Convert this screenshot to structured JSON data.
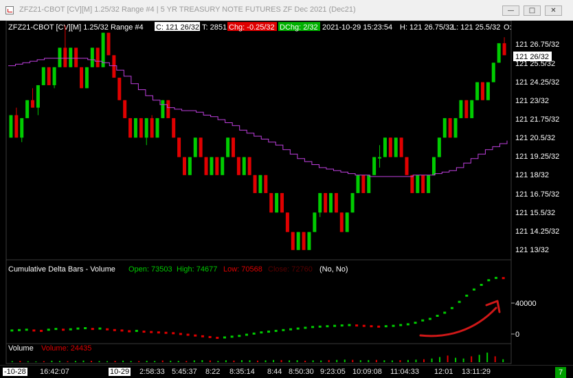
{
  "window": {
    "title": "ZFZ21-CBOT [CV][M]  1.25/32 Range  #4 | 5 YR TREASURY NOTE FUTURES ZF Dec 2021 (Dec21)",
    "min_label": "—",
    "max_label": "□",
    "close_label": "✕"
  },
  "header": {
    "symbol": "ZFZ21-CBOT [CV][M]  1.25/32 Range  #4",
    "close": "C: 121 26/32",
    "trades": "T: 2851",
    "chg": "Chg: -0.25/32",
    "dchg": "DChg: 2/32",
    "datetime": "2021-10-29 15:23:54",
    "high": "H: 121 26.75/32",
    "low": "L: 121 25.5/32",
    "open": "O:"
  },
  "price_axis": {
    "labels": [
      "121 26.75/32",
      "121 25.5/32",
      "121 24.25/32",
      "121 23/32",
      "121 21.75/32",
      "121 20.5/32",
      "121 19.25/32",
      "121 18/32",
      "121 16.75/32",
      "121 15.5/32",
      "121 14.25/32",
      "121 13/32"
    ],
    "current_label": "121 26/32"
  },
  "delta_panel": {
    "title": "Cumulative Delta Bars - Volume",
    "open": "Open: 73503",
    "high": "High: 74677",
    "low": "Low: 70568",
    "close": "Close: 72760",
    "flags": "(No, No)",
    "axis_labels": [
      "40000",
      "0"
    ]
  },
  "volume_panel": {
    "title": "Volume",
    "value": "Volume: 24435"
  },
  "time_axis": {
    "labels": [
      "-10-28",
      "16:42:07",
      "10-29",
      "2:58:33",
      "5:45:37",
      "8:22",
      "8:35:14",
      "8:44",
      "8:50:30",
      "9:23:05",
      "10:09:08",
      "11:04:33",
      "12:01",
      "13:11:29"
    ]
  },
  "badge": "7",
  "colors": {
    "up": "#00cc00",
    "down": "#e00000",
    "ma": "#c040e0",
    "annotation": "#d01818"
  },
  "chart_data": {
    "type": "candlestick",
    "price_unit": "32nds above 121",
    "candles": [
      {
        "o": 20.5,
        "h": 22.0,
        "l": 20.5,
        "c": 22.0
      },
      {
        "o": 22.0,
        "h": 22.5,
        "l": 20.5,
        "c": 20.5
      },
      {
        "o": 20.5,
        "h": 21.8,
        "l": 20.2,
        "c": 21.8
      },
      {
        "o": 21.8,
        "h": 23.0,
        "l": 21.8,
        "c": 23.0
      },
      {
        "o": 23.0,
        "h": 23.8,
        "l": 22.5,
        "c": 22.5
      },
      {
        "o": 22.5,
        "h": 24.0,
        "l": 22.0,
        "c": 24.0
      },
      {
        "o": 24.0,
        "h": 25.2,
        "l": 24.0,
        "c": 25.2
      },
      {
        "o": 25.2,
        "h": 25.2,
        "l": 24.0,
        "c": 24.0
      },
      {
        "o": 24.0,
        "h": 25.2,
        "l": 23.8,
        "c": 25.2
      },
      {
        "o": 25.2,
        "h": 26.5,
        "l": 25.2,
        "c": 26.5
      },
      {
        "o": 26.5,
        "h": 28.0,
        "l": 25.2,
        "c": 25.2
      },
      {
        "o": 25.2,
        "h": 26.5,
        "l": 25.2,
        "c": 26.5
      },
      {
        "o": 26.5,
        "h": 26.5,
        "l": 25.2,
        "c": 25.2
      },
      {
        "o": 25.2,
        "h": 25.2,
        "l": 23.8,
        "c": 23.8
      },
      {
        "o": 23.8,
        "h": 25.2,
        "l": 23.8,
        "c": 25.2
      },
      {
        "o": 25.2,
        "h": 26.5,
        "l": 25.2,
        "c": 26.5
      },
      {
        "o": 26.5,
        "h": 26.5,
        "l": 25.2,
        "c": 25.2
      },
      {
        "o": 25.2,
        "h": 27.5,
        "l": 25.2,
        "c": 27.5
      },
      {
        "o": 27.5,
        "h": 27.5,
        "l": 26.0,
        "c": 26.0
      },
      {
        "o": 26.0,
        "h": 26.0,
        "l": 24.5,
        "c": 24.5
      },
      {
        "o": 24.5,
        "h": 24.5,
        "l": 23.0,
        "c": 23.0
      },
      {
        "o": 23.0,
        "h": 23.0,
        "l": 21.8,
        "c": 21.8
      },
      {
        "o": 21.8,
        "h": 21.8,
        "l": 20.5,
        "c": 20.5
      },
      {
        "o": 20.5,
        "h": 21.8,
        "l": 20.5,
        "c": 21.8
      },
      {
        "o": 21.8,
        "h": 21.8,
        "l": 20.5,
        "c": 20.5
      },
      {
        "o": 20.5,
        "h": 21.8,
        "l": 20.0,
        "c": 21.8
      },
      {
        "o": 21.8,
        "h": 22.0,
        "l": 20.5,
        "c": 20.5
      },
      {
        "o": 20.5,
        "h": 21.8,
        "l": 20.5,
        "c": 21.8
      },
      {
        "o": 21.8,
        "h": 23.0,
        "l": 21.8,
        "c": 23.0
      },
      {
        "o": 23.0,
        "h": 23.0,
        "l": 21.8,
        "c": 21.8
      },
      {
        "o": 21.8,
        "h": 21.8,
        "l": 20.5,
        "c": 20.5
      },
      {
        "o": 20.5,
        "h": 20.5,
        "l": 19.2,
        "c": 19.2
      },
      {
        "o": 19.2,
        "h": 19.2,
        "l": 18.0,
        "c": 18.0
      },
      {
        "o": 18.0,
        "h": 19.2,
        "l": 18.0,
        "c": 19.2
      },
      {
        "o": 19.2,
        "h": 20.5,
        "l": 19.2,
        "c": 20.5
      },
      {
        "o": 20.5,
        "h": 20.5,
        "l": 19.2,
        "c": 19.2
      },
      {
        "o": 19.2,
        "h": 19.2,
        "l": 18.0,
        "c": 18.0
      },
      {
        "o": 18.0,
        "h": 19.2,
        "l": 18.0,
        "c": 19.2
      },
      {
        "o": 19.2,
        "h": 19.2,
        "l": 18.0,
        "c": 18.0
      },
      {
        "o": 18.0,
        "h": 19.2,
        "l": 18.0,
        "c": 19.2
      },
      {
        "o": 19.2,
        "h": 20.5,
        "l": 19.2,
        "c": 20.5
      },
      {
        "o": 20.5,
        "h": 20.5,
        "l": 19.2,
        "c": 19.2
      },
      {
        "o": 19.2,
        "h": 19.2,
        "l": 18.0,
        "c": 18.0
      },
      {
        "o": 18.0,
        "h": 19.2,
        "l": 18.0,
        "c": 19.2
      },
      {
        "o": 19.2,
        "h": 19.2,
        "l": 18.0,
        "c": 18.0
      },
      {
        "o": 18.0,
        "h": 18.0,
        "l": 16.8,
        "c": 16.8
      },
      {
        "o": 16.8,
        "h": 18.0,
        "l": 16.8,
        "c": 18.0
      },
      {
        "o": 18.0,
        "h": 18.0,
        "l": 16.8,
        "c": 16.8
      },
      {
        "o": 16.8,
        "h": 16.8,
        "l": 15.5,
        "c": 15.5
      },
      {
        "o": 15.5,
        "h": 16.8,
        "l": 15.5,
        "c": 16.8
      },
      {
        "o": 16.8,
        "h": 16.8,
        "l": 15.5,
        "c": 15.5
      },
      {
        "o": 15.5,
        "h": 15.5,
        "l": 14.2,
        "c": 14.2
      },
      {
        "o": 14.2,
        "h": 14.2,
        "l": 13.0,
        "c": 13.0
      },
      {
        "o": 13.0,
        "h": 14.2,
        "l": 13.0,
        "c": 14.2
      },
      {
        "o": 14.2,
        "h": 14.2,
        "l": 13.0,
        "c": 13.0
      },
      {
        "o": 13.0,
        "h": 14.2,
        "l": 13.0,
        "c": 14.2
      },
      {
        "o": 14.2,
        "h": 15.5,
        "l": 14.2,
        "c": 15.5
      },
      {
        "o": 15.5,
        "h": 16.8,
        "l": 15.2,
        "c": 16.8
      },
      {
        "o": 16.8,
        "h": 16.8,
        "l": 15.5,
        "c": 15.5
      },
      {
        "o": 15.5,
        "h": 16.8,
        "l": 15.5,
        "c": 16.8
      },
      {
        "o": 16.8,
        "h": 16.8,
        "l": 15.5,
        "c": 15.5
      },
      {
        "o": 15.5,
        "h": 15.5,
        "l": 14.2,
        "c": 14.2
      },
      {
        "o": 14.2,
        "h": 15.5,
        "l": 14.2,
        "c": 15.5
      },
      {
        "o": 15.5,
        "h": 16.8,
        "l": 15.5,
        "c": 16.8
      },
      {
        "o": 16.8,
        "h": 18.0,
        "l": 16.8,
        "c": 18.0
      },
      {
        "o": 18.0,
        "h": 18.0,
        "l": 16.8,
        "c": 16.8
      },
      {
        "o": 16.8,
        "h": 18.0,
        "l": 16.8,
        "c": 18.0
      },
      {
        "o": 18.0,
        "h": 19.2,
        "l": 18.0,
        "c": 19.2
      },
      {
        "o": 19.2,
        "h": 20.0,
        "l": 18.5,
        "c": 19.2
      },
      {
        "o": 19.2,
        "h": 20.5,
        "l": 19.2,
        "c": 20.5
      },
      {
        "o": 20.5,
        "h": 20.5,
        "l": 19.2,
        "c": 19.2
      },
      {
        "o": 19.2,
        "h": 20.5,
        "l": 19.2,
        "c": 20.5
      },
      {
        "o": 20.5,
        "h": 20.5,
        "l": 19.2,
        "c": 19.2
      },
      {
        "o": 19.2,
        "h": 19.2,
        "l": 18.0,
        "c": 18.0
      },
      {
        "o": 18.0,
        "h": 18.0,
        "l": 16.8,
        "c": 16.8
      },
      {
        "o": 16.8,
        "h": 18.0,
        "l": 16.8,
        "c": 18.0
      },
      {
        "o": 18.0,
        "h": 18.0,
        "l": 16.8,
        "c": 16.8
      },
      {
        "o": 16.8,
        "h": 18.0,
        "l": 16.8,
        "c": 18.0
      },
      {
        "o": 18.0,
        "h": 19.2,
        "l": 18.0,
        "c": 19.2
      },
      {
        "o": 19.2,
        "h": 20.5,
        "l": 19.2,
        "c": 20.5
      },
      {
        "o": 20.5,
        "h": 21.8,
        "l": 20.5,
        "c": 21.8
      },
      {
        "o": 21.8,
        "h": 21.8,
        "l": 20.5,
        "c": 20.5
      },
      {
        "o": 20.5,
        "h": 21.8,
        "l": 20.5,
        "c": 21.8
      },
      {
        "o": 21.8,
        "h": 23.0,
        "l": 21.8,
        "c": 23.0
      },
      {
        "o": 23.0,
        "h": 23.0,
        "l": 21.8,
        "c": 21.8
      },
      {
        "o": 21.8,
        "h": 23.0,
        "l": 21.8,
        "c": 23.0
      },
      {
        "o": 23.0,
        "h": 24.2,
        "l": 23.0,
        "c": 24.2
      },
      {
        "o": 24.2,
        "h": 24.2,
        "l": 23.0,
        "c": 23.0
      },
      {
        "o": 23.0,
        "h": 24.2,
        "l": 23.0,
        "c": 24.2
      },
      {
        "o": 24.2,
        "h": 25.5,
        "l": 24.2,
        "c": 25.5
      },
      {
        "o": 25.5,
        "h": 26.8,
        "l": 25.5,
        "c": 26.8
      },
      {
        "o": 26.8,
        "h": 27.2,
        "l": 26.0,
        "c": 26.0
      }
    ],
    "ma": [
      25.3,
      25.4,
      25.5,
      25.6,
      25.7,
      25.8,
      25.8,
      25.8,
      25.8,
      25.8,
      25.8,
      25.7,
      25.6,
      25.5,
      25.3,
      25.0,
      24.6,
      24.1,
      23.7,
      23.3,
      23.0,
      22.7,
      22.5,
      22.4,
      22.3,
      22.3,
      22.2,
      22.0,
      21.9,
      21.7,
      21.5,
      21.3,
      21.0,
      20.8,
      20.6,
      20.4,
      20.2,
      20.0,
      19.7,
      19.4,
      19.1,
      18.9,
      18.7,
      18.5,
      18.4,
      18.3,
      18.2,
      18.1,
      18.0,
      18.0,
      17.9,
      17.9,
      17.9,
      17.9,
      17.9,
      17.9,
      18.0,
      18.0,
      18.0,
      18.1,
      18.2,
      18.3,
      18.5,
      18.8,
      19.1,
      19.4,
      19.7,
      19.9,
      20.1,
      20.3
    ],
    "cum_delta": [
      5000,
      5500,
      6000,
      5000,
      4500,
      6000,
      7000,
      6000,
      6500,
      7500,
      8000,
      7000,
      7500,
      6500,
      5500,
      5000,
      4000,
      4500,
      3500,
      3000,
      2500,
      2000,
      1500,
      500,
      -500,
      -1500,
      -2500,
      -3500,
      -4500,
      -4000,
      -3000,
      -2000,
      -500,
      1000,
      2500,
      3500,
      4500,
      5500,
      6500,
      7500,
      8500,
      9500,
      10000,
      10500,
      11000,
      11500,
      12000,
      11500,
      11000,
      10500,
      10000,
      10500,
      11000,
      12000,
      13000,
      15000,
      18000,
      20000,
      24000,
      28000,
      34000,
      42000,
      50000,
      58000,
      64000,
      70000,
      73000,
      72760
    ],
    "cum_delta_axis": [
      "40000",
      "0"
    ],
    "volume": [
      1500,
      1800,
      1200,
      1000,
      1400,
      2000,
      1600,
      1300,
      1700,
      2200,
      1900,
      1500,
      1400,
      1800,
      2100,
      1600,
      1500,
      1900,
      1700,
      2300,
      2000,
      1800,
      1600,
      2500,
      2800,
      2400,
      1700,
      2600,
      2200,
      2800,
      2600,
      2100,
      2500,
      3000,
      2900,
      2500,
      2700,
      2000,
      2500,
      2300,
      2900,
      3100,
      3500,
      3200,
      2700,
      2900,
      3100,
      2600,
      2400,
      2800,
      3000,
      3500,
      4000,
      5000,
      7000,
      9000,
      6000,
      5000,
      8000,
      10000,
      13000,
      8000,
      4000
    ],
    "volume_value": 24435
  }
}
